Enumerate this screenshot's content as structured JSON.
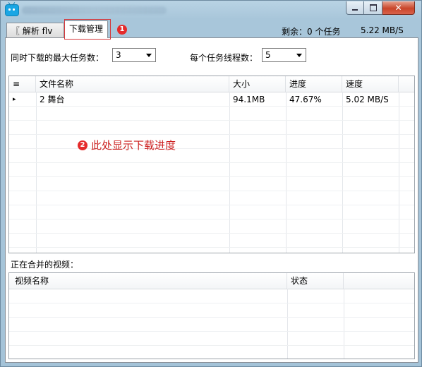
{
  "window": {
    "icon": "tv-icon",
    "controls": {
      "minimize": "minimize-icon",
      "maximize": "maximize-icon",
      "close": "close-icon"
    }
  },
  "tabs": [
    {
      "label": "〖 解析 flv 〗",
      "active": false
    },
    {
      "label": "下载管理",
      "active": true
    }
  ],
  "annotations": {
    "badge1": "1",
    "badge2": "2",
    "note": "此处显示下载进度",
    "color": "#d5383b"
  },
  "status": {
    "remaining": "剩余：0 个任务",
    "speed": "5.22 MB/S"
  },
  "settings": {
    "max_tasks_label": "同时下载的最大任务数：",
    "max_tasks_value": "3",
    "threads_label": "每个任务线程数：",
    "threads_value": "5"
  },
  "downloads": {
    "columns": [
      "≡",
      "文件名称",
      "大小",
      "进度",
      "速度"
    ],
    "rows": [
      {
        "marker": "▸",
        "name": "2 舞台",
        "size": "94.1MB",
        "progress": "47.67%",
        "speed": "5.02 MB/S"
      }
    ]
  },
  "merge": {
    "label": "正在合并的视频：",
    "columns": [
      "视频名称",
      "状态"
    ]
  }
}
